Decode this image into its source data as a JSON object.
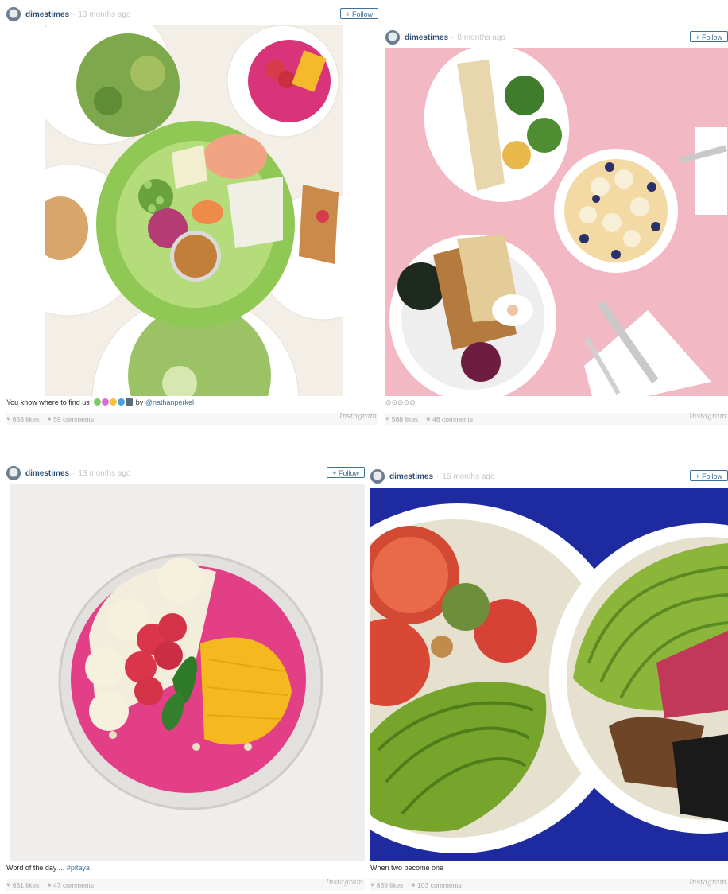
{
  "posts": [
    {
      "username": "dimestimes",
      "separator": "·",
      "time": "13 months ago",
      "follow_label": "+ Follow",
      "caption": {
        "text": "You know where to find us",
        "by": "by",
        "mention": "@nathanperkel",
        "emoji_colors": [
          "#7cc86b",
          "#d96bd3",
          "#f2c43a",
          "#4aa3e0",
          "#5a6b7a"
        ]
      },
      "likes": "658 likes",
      "comments": "59 comments",
      "brand": "Instagram",
      "image_desc": "salad-spread"
    },
    {
      "username": "dimestimes",
      "separator": "·",
      "time": "8 months ago",
      "follow_label": "+ Follow",
      "caption": {
        "text": "⊙⊙⊙⊙⊙"
      },
      "likes": "568 likes",
      "comments": "46 comments",
      "brand": "Instagram",
      "image_desc": "pink-table-bowls"
    },
    {
      "username": "dimestimes",
      "separator": "·",
      "time": "13 months ago",
      "follow_label": "+ Follow",
      "caption": {
        "text": "Word of the day ...",
        "hashtag": "#pitaya"
      },
      "likes": "631 likes",
      "comments": "47 comments",
      "brand": "Instagram",
      "image_desc": "pitaya-bowl"
    },
    {
      "username": "dimestimes",
      "separator": "·",
      "time": "15 months ago",
      "follow_label": "+ Follow",
      "caption": {
        "text": "When two become one"
      },
      "likes": "839 likes",
      "comments": "103 comments",
      "brand": "Instagram",
      "image_desc": "avocado-bowls"
    }
  ],
  "colors": {
    "link": "#3f729b",
    "username": "#2d4f73",
    "muted": "#c6c6c6",
    "pink_bg": "#f2b9c5",
    "blue_bg": "#1d2aa0"
  }
}
